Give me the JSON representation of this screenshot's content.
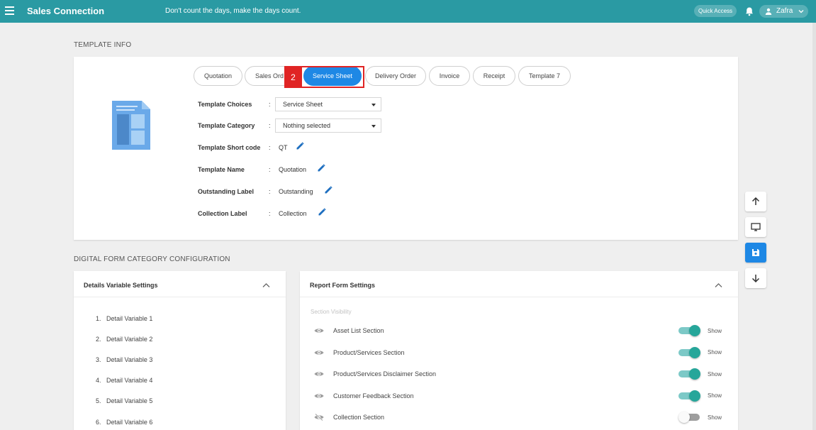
{
  "topbar": {
    "brand": "Sales Connection",
    "tagline": "Don't count the days, make the days count.",
    "quick_access": "Quick Access",
    "user_name": "Zafra"
  },
  "template_info": {
    "section_title": "TEMPLATE INFO",
    "tabs": [
      {
        "label": "Quotation"
      },
      {
        "label": "Sales Ord"
      },
      {
        "label": "Service Sheet"
      },
      {
        "label": "Delivery Order"
      },
      {
        "label": "Invoice"
      },
      {
        "label": "Receipt"
      },
      {
        "label": "Template 7"
      }
    ],
    "active_tab": "Service Sheet",
    "highlight_step": "2",
    "colon": ":",
    "fields": {
      "template_choices": {
        "label": "Template Choices",
        "value": "Service Sheet"
      },
      "template_category": {
        "label": "Template Category",
        "value": "Nothing selected"
      },
      "template_short_code": {
        "label": "Template Short code",
        "value": "QT"
      },
      "template_name": {
        "label": "Template Name",
        "value": "Quotation"
      },
      "outstanding_label": {
        "label": "Outstanding Label",
        "value": "Outstanding"
      },
      "collection_label": {
        "label": "Collection Label",
        "value": "Collection"
      }
    }
  },
  "digital_form": {
    "section_title": "DIGITAL FORM CATEGORY CONFIGURATION",
    "details": {
      "title": "Details Variable Settings",
      "items": [
        {
          "num": "1.",
          "label": "Detail Variable 1"
        },
        {
          "num": "2.",
          "label": "Detail Variable 2"
        },
        {
          "num": "3.",
          "label": "Detail Variable 3"
        },
        {
          "num": "4.",
          "label": "Detail Variable 4"
        },
        {
          "num": "5.",
          "label": "Detail Variable 5"
        },
        {
          "num": "6.",
          "label": "Detail Variable 6"
        }
      ]
    },
    "report": {
      "title": "Report Form Settings",
      "visibility_label": "Section Visibility",
      "rows": [
        {
          "label": "Asset List Section",
          "state": "Show",
          "on": true
        },
        {
          "label": "Product/Services Section",
          "state": "Show",
          "on": true
        },
        {
          "label": "Product/Services Disclaimer Section",
          "state": "Show",
          "on": true
        },
        {
          "label": "Customer Feedback Section",
          "state": "Show",
          "on": true
        },
        {
          "label": "Collection Section",
          "state": "Show",
          "on": false
        }
      ]
    }
  },
  "colors": {
    "topbar": "#2a9aa3",
    "accent_blue": "#1e88e5",
    "highlight_red": "#e02424",
    "toggle_on": "#26a69a"
  }
}
